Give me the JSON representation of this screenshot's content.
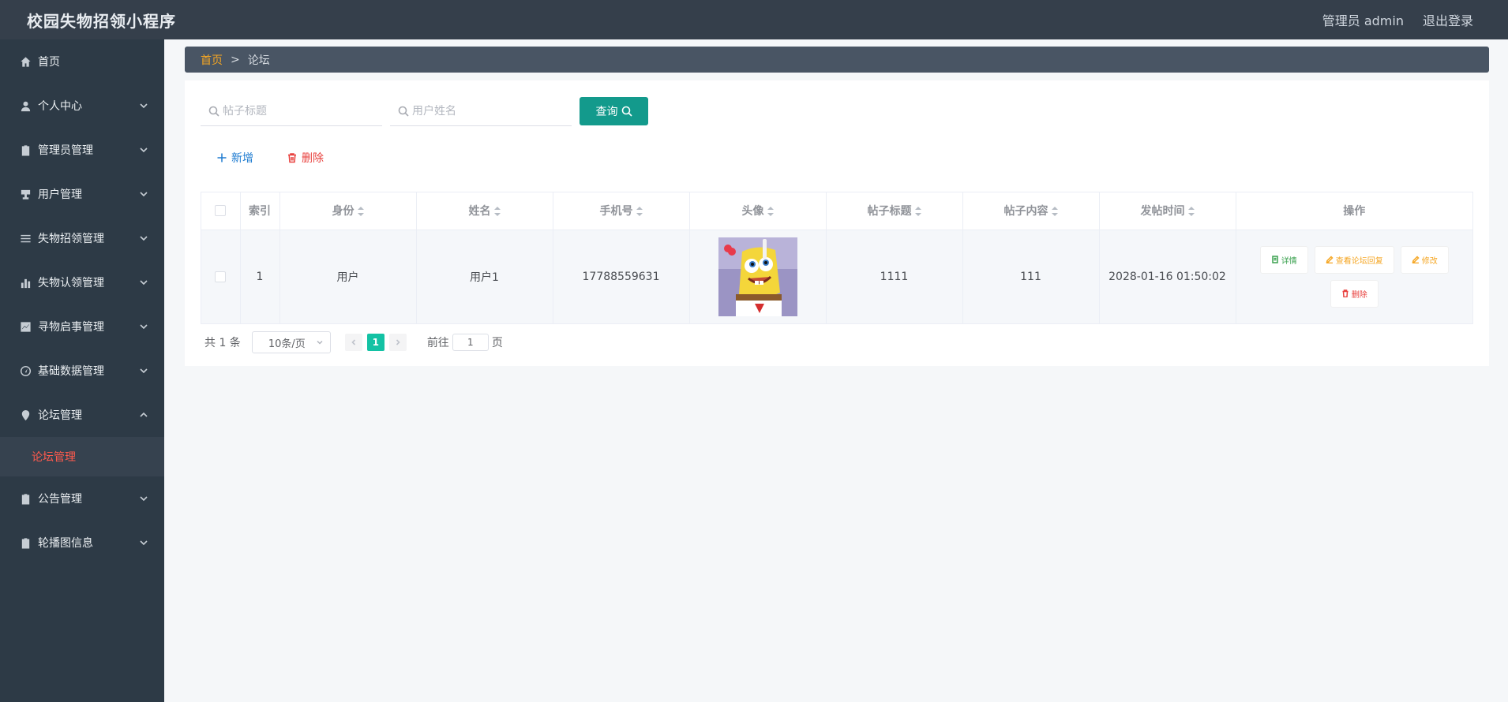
{
  "header": {
    "title": "校园失物招领小程序",
    "user_label": "管理员 admin",
    "logout_label": "退出登录"
  },
  "sidebar": {
    "items": [
      {
        "label": "首页",
        "icon": "home-icon"
      },
      {
        "label": "个人中心",
        "icon": "user-icon"
      },
      {
        "label": "管理员管理",
        "icon": "clipboard-icon"
      },
      {
        "label": "用户管理",
        "icon": "stamp-icon"
      },
      {
        "label": "失物招领管理",
        "icon": "list-icon"
      },
      {
        "label": "失物认领管理",
        "icon": "bar-chart-icon"
      },
      {
        "label": "寻物启事管理",
        "icon": "line-chart-icon"
      },
      {
        "label": "基础数据管理",
        "icon": "gauge-icon"
      },
      {
        "label": "论坛管理",
        "icon": "location-icon"
      },
      {
        "label": "公告管理",
        "icon": "notice-icon"
      },
      {
        "label": "轮播图信息",
        "icon": "carousel-icon"
      }
    ],
    "active_sub": "论坛管理"
  },
  "breadcrumb": {
    "home": "首页",
    "separator": ">",
    "current": "论坛"
  },
  "search": {
    "title_placeholder": "帖子标题",
    "name_placeholder": "用户姓名",
    "query_label": "查询"
  },
  "actions": {
    "add_label": "新增",
    "delete_label": "删除"
  },
  "table": {
    "columns": [
      "索引",
      "身份",
      "姓名",
      "手机号",
      "头像",
      "帖子标题",
      "帖子内容",
      "发帖时间",
      "操作"
    ],
    "rows": [
      {
        "index": "1",
        "identity": "用户",
        "name": "用户1",
        "phone": "17788559631",
        "avatar": "spongebob-avatar",
        "title": "1111",
        "content": "111",
        "time": "2028-01-16 01:50:02"
      }
    ],
    "ops": {
      "detail": "详情",
      "replies": "查看论坛回复",
      "edit": "修改",
      "delete": "删除"
    }
  },
  "pagination": {
    "total": "共 1 条",
    "page_size": "10条/页",
    "current_page": "1",
    "goto_label": "前往",
    "goto_value": "1",
    "page_suffix": "页"
  },
  "colors": {
    "topbar": "#353f4b",
    "sidebar": "#2d3a46",
    "accent": "#139a8c",
    "active_menu": "#ff5a4d",
    "page_active": "#13c2a4"
  }
}
